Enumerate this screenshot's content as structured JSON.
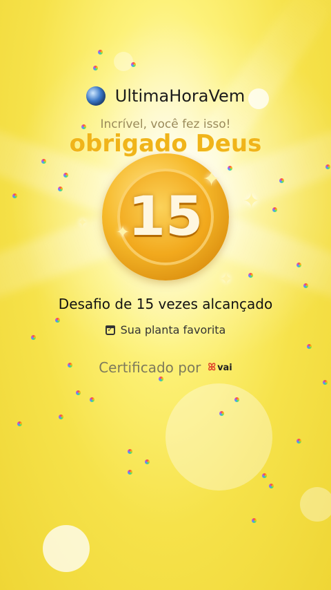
{
  "header": {
    "app_name": "UltimaHoraVem"
  },
  "subtitle": "Incrível, você fez isso!",
  "overlay_text": "obrigado Deus",
  "medal": {
    "number": "15"
  },
  "achievement": {
    "title": "Desafio de 15 vezes alcançado",
    "task_label": "Sua planta favorita"
  },
  "certified": {
    "label": "Certificado por",
    "brand_icon": "ꕤ",
    "brand_name": "vai"
  },
  "colors": {
    "background": "#f6e24a",
    "medal_gold": "#f2a91d",
    "overlay_text": "#f0b41a"
  }
}
